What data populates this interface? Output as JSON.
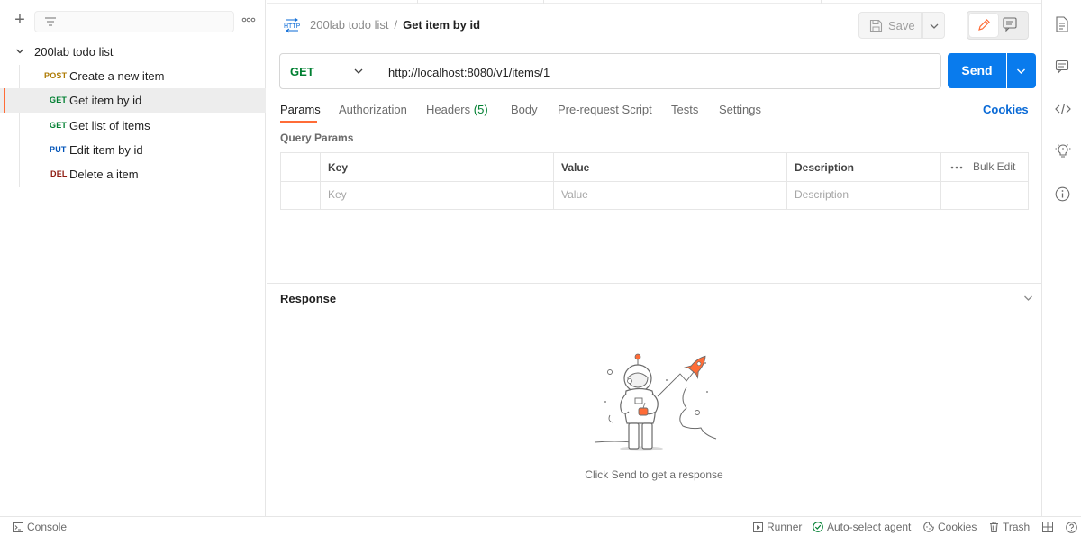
{
  "sidebar": {
    "collection_name": "200lab todo list",
    "requests": [
      {
        "method": "POST",
        "name": "Create a new item",
        "active": false
      },
      {
        "method": "GET",
        "name": "Get item by id",
        "active": true
      },
      {
        "method": "GET",
        "name": "Get list of items",
        "active": false
      },
      {
        "method": "PUT",
        "name": "Edit item by id",
        "active": false
      },
      {
        "method": "DEL",
        "name": "Delete a item",
        "active": false
      }
    ]
  },
  "header": {
    "http_icon_label": "HTTP",
    "collection": "200lab todo list",
    "separator": "/",
    "request_name": "Get item by id",
    "save_label": "Save"
  },
  "request": {
    "method": "GET",
    "url": "http://localhost:8080/v1/items/1",
    "send_label": "Send"
  },
  "tabs": [
    {
      "label": "Params",
      "active": true
    },
    {
      "label": "Authorization"
    },
    {
      "label": "Headers",
      "count": "(5)"
    },
    {
      "label": "Body"
    },
    {
      "label": "Pre-request Script"
    },
    {
      "label": "Tests"
    },
    {
      "label": "Settings"
    }
  ],
  "cookies_label": "Cookies",
  "query_params": {
    "title": "Query Params",
    "columns": [
      "Key",
      "Value",
      "Description"
    ],
    "placeholders": [
      "Key",
      "Value",
      "Description"
    ],
    "bulk_edit": "Bulk Edit"
  },
  "response": {
    "title": "Response",
    "hint": "Click Send to get a response"
  },
  "statusbar": {
    "console": "Console",
    "runner": "Runner",
    "agent": "Auto-select agent",
    "cookies": "Cookies",
    "trash": "Trash"
  },
  "colors": {
    "accent": "#ff6c37",
    "send": "#097bed",
    "get": "#007f31",
    "post": "#ad7a03",
    "put": "#0053b8",
    "del": "#8e1a10"
  }
}
